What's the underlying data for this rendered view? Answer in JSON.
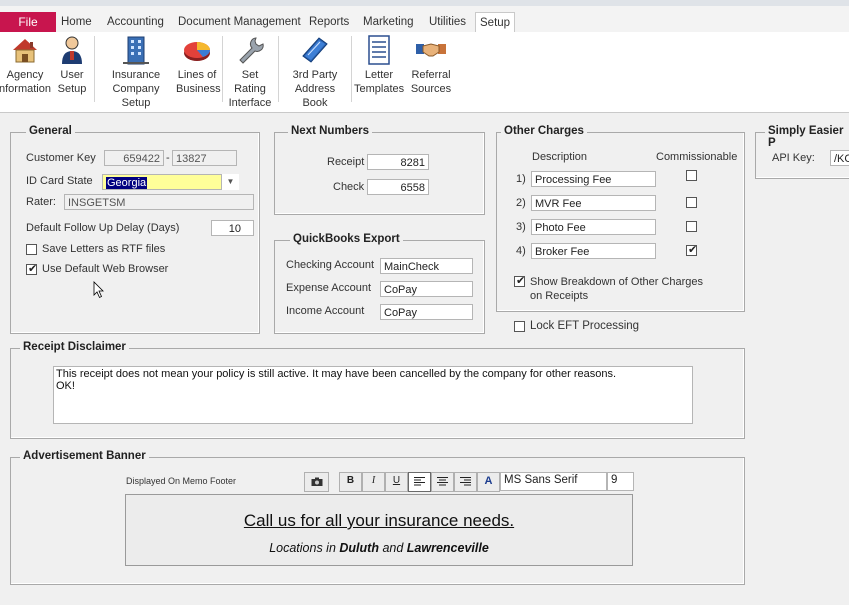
{
  "menu": {
    "tabs": [
      "File",
      "Home",
      "Accounting",
      "Document Management",
      "Reports",
      "Marketing",
      "Utilities",
      "Setup"
    ],
    "active": "Setup"
  },
  "ribbon": {
    "buttons": [
      {
        "line1": "Agency",
        "line2": "nformation"
      },
      {
        "line1": "User",
        "line2": "Setup"
      },
      {
        "line1": "Insurance",
        "line2": "Company Setup"
      },
      {
        "line1": "Lines of",
        "line2": "Business"
      },
      {
        "line1": "Set Rating",
        "line2": "Interface"
      },
      {
        "line1": "3rd Party",
        "line2": "Address Book"
      },
      {
        "line1": "Letter",
        "line2": "Templates"
      },
      {
        "line1": "Referral",
        "line2": "Sources"
      }
    ]
  },
  "general": {
    "title": "General",
    "customer_key_label": "Customer Key",
    "customer_key_1": "659422",
    "customer_key_sep": "-",
    "customer_key_2": "13827",
    "id_card_state_label": "ID Card State",
    "id_card_state_value": "Georgia",
    "rater_label": "Rater:",
    "rater_value": "INSGETSM",
    "follow_up_label": "Default Follow Up Delay (Days)",
    "follow_up_value": "10",
    "save_rtf_label": "Save Letters as RTF files",
    "save_rtf_checked": false,
    "default_browser_label": "Use Default Web Browser",
    "default_browser_checked": true
  },
  "next_numbers": {
    "title": "Next Numbers",
    "receipt_label": "Receipt",
    "receipt_value": "8281",
    "check_label": "Check",
    "check_value": "6558"
  },
  "quickbooks": {
    "title": "QuickBooks Export",
    "checking_label": "Checking Account",
    "checking_value": "MainCheck",
    "expense_label": "Expense Account",
    "expense_value": "CoPay",
    "income_label": "Income Account",
    "income_value": "CoPay"
  },
  "other_charges": {
    "title": "Other Charges",
    "col_description": "Description",
    "col_commissionable": "Commissionable",
    "rows": [
      {
        "num": "1)",
        "desc": "Processing Fee",
        "checked": false
      },
      {
        "num": "2)",
        "desc": "MVR Fee",
        "checked": false
      },
      {
        "num": "3)",
        "desc": "Photo Fee",
        "checked": false
      },
      {
        "num": "4)",
        "desc": "Broker Fee",
        "checked": true
      }
    ],
    "breakdown_line1": "Show Breakdown of Other Charges",
    "breakdown_line2": "on Receipts",
    "breakdown_checked": true
  },
  "lock_eft": {
    "label": "Lock EFT Processing",
    "checked": false
  },
  "simply_easier": {
    "title": "Simply Easier P",
    "api_key_label": "API Key:",
    "api_key_value": "/KC"
  },
  "receipt_disclaimer": {
    "title": "Receipt Disclaimer",
    "line1": "This receipt does not mean your policy is still active. It may have been cancelled by the company for other reasons.",
    "line2": "OK!"
  },
  "advertisement": {
    "title": "Advertisement Banner",
    "footer_label": "Displayed On Memo Footer",
    "font_name": "MS Sans Serif",
    "font_size": "9",
    "toolbar": {
      "bold": "B",
      "italic": "I",
      "underline": "U",
      "color": "A"
    },
    "banner_line1": "Call us for all your insurance needs.",
    "banner_line2_a": "Locations in ",
    "banner_line2_b": "Duluth",
    "banner_line2_c": " and ",
    "banner_line2_d": "Lawrenceville"
  }
}
